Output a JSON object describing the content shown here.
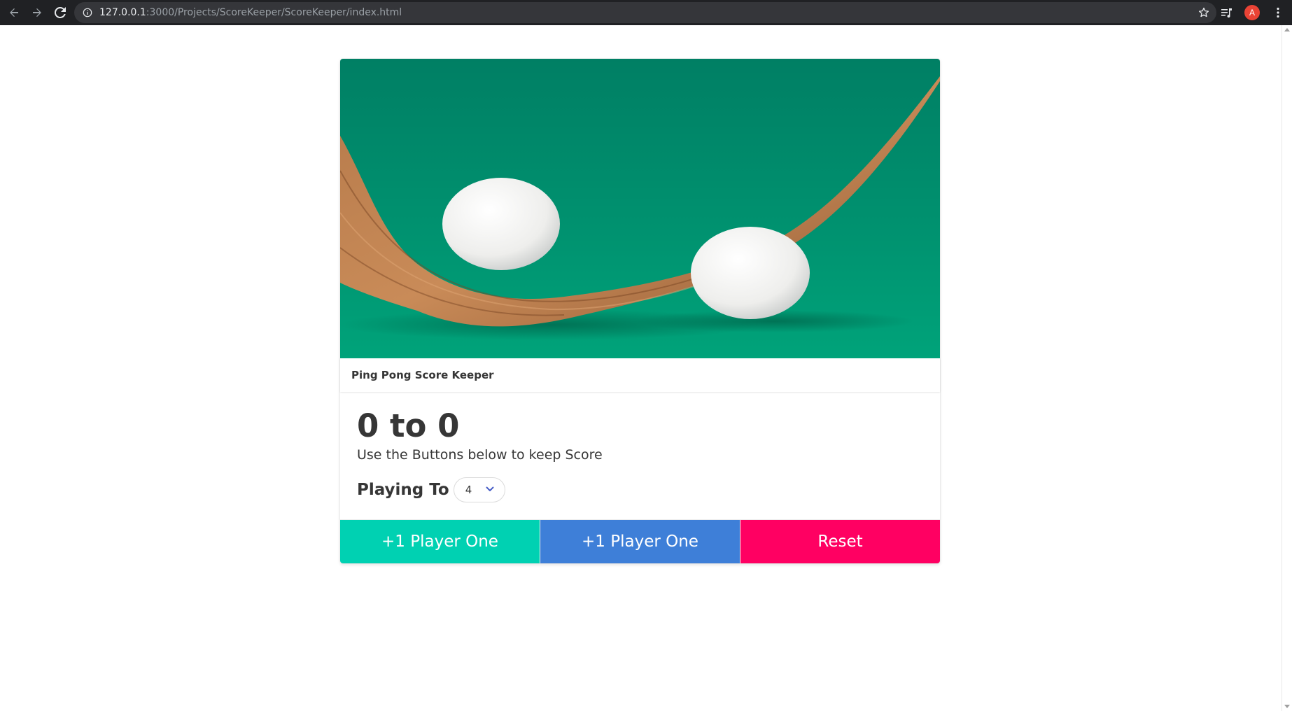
{
  "browser": {
    "url_host": "127.0.0.1",
    "url_rest": ":3000/Projects/ScoreKeeper/ScoreKeeper/index.html",
    "avatar_letter": "A"
  },
  "card": {
    "header_title": "Ping Pong Score Keeper",
    "score": "0 to 0",
    "subtitle": "Use the Buttons below to keep Score",
    "playing_to_label": "Playing To",
    "playing_to_value": "4"
  },
  "footer": {
    "p1_button": "+1 Player One",
    "p2_button": "+1 Player One",
    "reset_button": "Reset"
  },
  "colors": {
    "p1": "#00d1b2",
    "p2": "#3e7fd8",
    "reset": "#ff0062",
    "image_bg": "#00906c"
  },
  "icons": [
    "back-icon",
    "forward-icon",
    "reload-icon",
    "info-icon",
    "star-icon",
    "reading-list-icon",
    "avatar",
    "menu-icon",
    "chevron-down-icon"
  ]
}
